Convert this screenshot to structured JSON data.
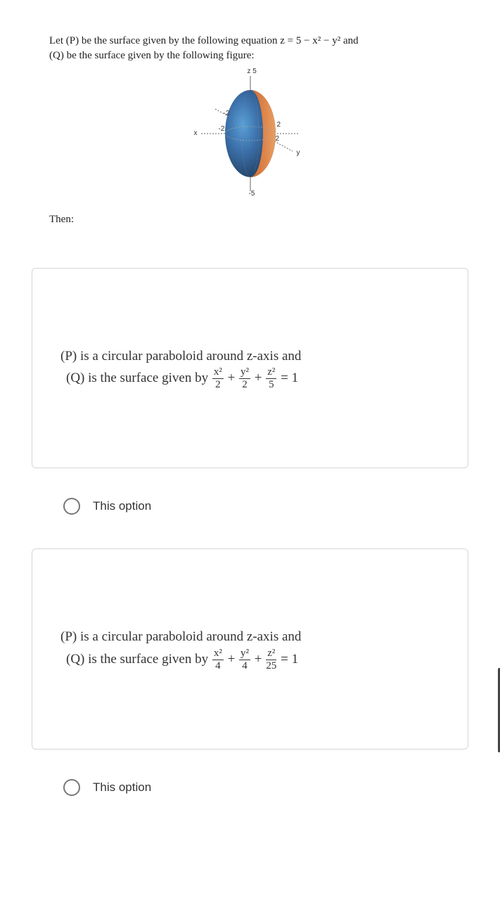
{
  "intro_line1": "Let (P) be the surface given by the following equation z = 5 − x² − y² and",
  "intro_line2": "(Q) be the surface given by the following figure:",
  "figure": {
    "z_top": "5",
    "z_bottom": "-5",
    "x_label": "x",
    "y_label": "y",
    "tick1": "-2",
    "tick2": "2",
    "z_axis": "z"
  },
  "then": "Then:",
  "option1": {
    "line1_prefix": "(P) is a circular paraboloid around z-axis and",
    "line2_prefix": "(Q) is the surface given by ",
    "num1": "x²",
    "den1": "2",
    "num2": "y²",
    "den2": "2",
    "num3": "z²",
    "den3": "5",
    "eq": " = 1",
    "plus": " + ",
    "select_label": "This option"
  },
  "option2": {
    "line1_prefix": "(P) is a circular paraboloid around z-axis and",
    "line2_prefix": "(Q) is the surface given by ",
    "num1": "x²",
    "den1": "4",
    "num2": "y²",
    "den2": "4",
    "num3": "z²",
    "den3": "25",
    "eq": " = 1",
    "plus": " + ",
    "select_label": "This option"
  }
}
